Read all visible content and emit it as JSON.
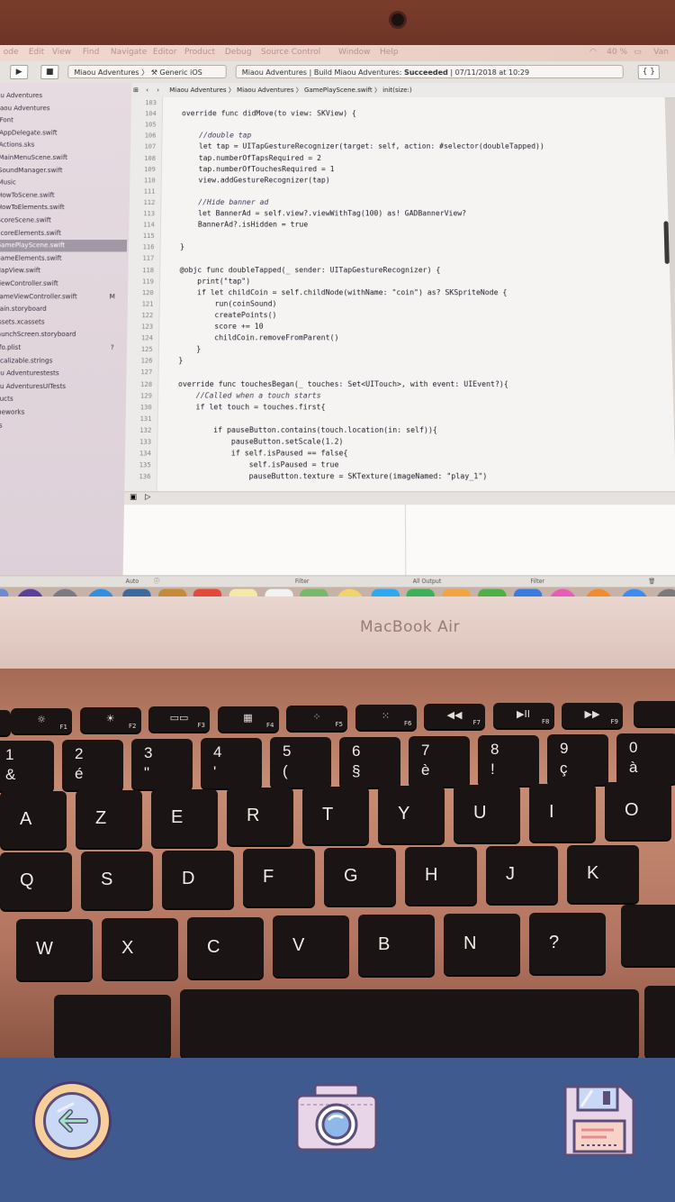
{
  "mac_menubar": {
    "items": [
      "ode",
      "Edit",
      "View",
      "Find",
      "Navigate",
      "Editor",
      "Product",
      "Debug",
      "Source Control",
      "Window",
      "Help"
    ],
    "battery": "40 %",
    "right_text": "Van"
  },
  "xcode_toolbar": {
    "scheme": "Miaou Adventures",
    "destination": "Generic iOS Device",
    "status_project": "Miaou Adventures",
    "status_build": "Build Miaou Adventures:",
    "status_result": "Succeeded",
    "status_time": "07/11/2018 at 10:29"
  },
  "jump_bar": {
    "crumbs": [
      "Miaou Adventures",
      "Miaou Adventures",
      "GamePlayScene.swift",
      "init(size:)"
    ]
  },
  "navigator": {
    "items": [
      {
        "label": "u Adventures",
        "badge": ""
      },
      {
        "label": "aou Adventures",
        "badge": ""
      },
      {
        "label": "Font",
        "badge": ""
      },
      {
        "label": "AppDelegate.swift",
        "badge": ""
      },
      {
        "label": "Actions.sks",
        "badge": ""
      },
      {
        "label": "MainMenuScene.swift",
        "badge": ""
      },
      {
        "label": "SoundManager.swift",
        "badge": ""
      },
      {
        "label": "Music",
        "badge": ""
      },
      {
        "label": "HowToScene.swift",
        "badge": ""
      },
      {
        "label": "HowToElements.swift",
        "badge": ""
      },
      {
        "label": "ScoreScene.swift",
        "badge": ""
      },
      {
        "label": "ScoreElements.swift",
        "badge": ""
      },
      {
        "label": "GamePlayScene.swift",
        "badge": "",
        "selected": true
      },
      {
        "label": "GameElements.swift",
        "badge": ""
      },
      {
        "label": "MapView.swift",
        "badge": ""
      },
      {
        "label": "ViewController.swift",
        "badge": ""
      },
      {
        "label": "GameViewController.swift",
        "badge": "M"
      },
      {
        "label": "Main.storyboard",
        "badge": ""
      },
      {
        "label": "Assets.xcassets",
        "badge": ""
      },
      {
        "label": "LaunchScreen.storyboard",
        "badge": ""
      },
      {
        "label": "Info.plist",
        "badge": "?"
      },
      {
        "label": "Localizable.strings",
        "badge": ""
      },
      {
        "label": "aou Adventurestests",
        "badge": ""
      },
      {
        "label": "aou AdventuresUITests",
        "badge": ""
      },
      {
        "label": "oducts",
        "badge": ""
      },
      {
        "label": "ameworks",
        "badge": ""
      },
      {
        "label": "ods",
        "badge": ""
      }
    ]
  },
  "editor": {
    "line_numbers": [
      "103",
      "104",
      "105",
      "106",
      "107",
      "108",
      "109",
      "110",
      "111",
      "112",
      "113",
      "114",
      "115",
      "116",
      "117",
      "118",
      "119",
      "120",
      "121",
      "122",
      "123",
      "124",
      "125",
      "126",
      "127",
      "128",
      "129",
      "130",
      "131",
      "132",
      "133",
      "134",
      "135",
      "136"
    ],
    "lines": [
      {
        "text": "",
        "comment": false
      },
      {
        "text": "override func didMove(to view: SKView) {",
        "comment": false
      },
      {
        "text": "",
        "comment": false
      },
      {
        "text": "    //double tap",
        "comment": true
      },
      {
        "text": "    let tap = UITapGestureRecognizer(target: self, action: #selector(doubleTapped))",
        "comment": false
      },
      {
        "text": "    tap.numberOfTapsRequired = 2",
        "comment": false
      },
      {
        "text": "    tap.numberOfTouchesRequired = 1",
        "comment": false
      },
      {
        "text": "    view.addGestureRecognizer(tap)",
        "comment": false
      },
      {
        "text": "",
        "comment": false
      },
      {
        "text": "    //Hide banner ad",
        "comment": true
      },
      {
        "text": "    let BannerAd = self.view?.viewWithTag(100) as! GADBannerView?",
        "comment": false
      },
      {
        "text": "    BannerAd?.isHidden = true",
        "comment": false
      },
      {
        "text": "",
        "comment": false
      },
      {
        "text": "}",
        "comment": false
      },
      {
        "text": "",
        "comment": false
      },
      {
        "text": "@objc func doubleTapped(_ sender: UITapGestureRecognizer) {",
        "comment": false
      },
      {
        "text": "    print(\"tap\")",
        "comment": false
      },
      {
        "text": "    if let childCoin = self.childNode(withName: \"coin\") as? SKSpriteNode {",
        "comment": false
      },
      {
        "text": "        run(coinSound)",
        "comment": false
      },
      {
        "text": "        createPoints()",
        "comment": false
      },
      {
        "text": "        score += 10",
        "comment": false
      },
      {
        "text": "        childCoin.removeFromParent()",
        "comment": false
      },
      {
        "text": "    }",
        "comment": false
      },
      {
        "text": "}",
        "comment": false
      },
      {
        "text": "",
        "comment": false
      },
      {
        "text": "override func touchesBegan(_ touches: Set<UITouch>, with event: UIEvent?){",
        "comment": false
      },
      {
        "text": "    //Called when a touch starts",
        "comment": true
      },
      {
        "text": "    if let touch = touches.first{",
        "comment": false
      },
      {
        "text": "",
        "comment": false
      },
      {
        "text": "        if pauseButton.contains(touch.location(in: self)){",
        "comment": false
      },
      {
        "text": "            pauseButton.setScale(1.2)",
        "comment": false
      },
      {
        "text": "            if self.isPaused == false{",
        "comment": false
      },
      {
        "text": "                self.isPaused = true",
        "comment": false
      },
      {
        "text": "                pauseButton.texture = SKTexture(imageNamed: \"play_1\")",
        "comment": false
      }
    ]
  },
  "debug_area": {
    "auto_label": "Auto",
    "filter_left": "Filter",
    "output_label": "All Output",
    "filter_right": "Filter"
  },
  "dock": {
    "calendar_day": "9",
    "icons": [
      "finder-icon",
      "siri-icon",
      "launchpad-icon",
      "safari-icon",
      "photo-app-icon",
      "notes-icon",
      "calendar-icon",
      "stickies-icon",
      "reminders-icon",
      "maps-icon",
      "photos-icon",
      "messages-icon",
      "facetime-icon",
      "pages-icon",
      "numbers-icon",
      "keynote-icon",
      "itunes-icon",
      "ibooks-icon",
      "appstore-icon",
      "preferences-icon"
    ]
  },
  "laptop": {
    "brand": "MacBook Air"
  },
  "keyboard": {
    "fn_row": [
      {
        "icon": "☼",
        "label": "F1"
      },
      {
        "icon": "☀",
        "label": "F2"
      },
      {
        "icon": "▭▭",
        "label": "F3"
      },
      {
        "icon": "▦",
        "label": "F4"
      },
      {
        "icon": "⁘",
        "label": "F5"
      },
      {
        "icon": "⁙",
        "label": "F6"
      },
      {
        "icon": "◀◀",
        "label": "F7"
      },
      {
        "icon": "▶II",
        "label": "F8"
      },
      {
        "icon": "▶▶",
        "label": "F9"
      }
    ],
    "number_row": [
      {
        "top": "1",
        "bottom": "&"
      },
      {
        "top": "2",
        "bottom": "é"
      },
      {
        "top": "3",
        "bottom": "\""
      },
      {
        "top": "4",
        "bottom": "'"
      },
      {
        "top": "5",
        "bottom": "("
      },
      {
        "top": "6",
        "bottom": "§"
      },
      {
        "top": "7",
        "bottom": "è"
      },
      {
        "top": "8",
        "bottom": "!"
      },
      {
        "top": "9",
        "bottom": "ç"
      },
      {
        "top": "0",
        "bottom": "à"
      }
    ],
    "row1": [
      "A",
      "Z",
      "E",
      "R",
      "T",
      "Y",
      "U",
      "I",
      "O"
    ],
    "row2": [
      "Q",
      "S",
      "D",
      "F",
      "G",
      "H",
      "J",
      "K"
    ],
    "row3": [
      "W",
      "X",
      "C",
      "V",
      "B",
      "N",
      "?"
    ]
  },
  "app_toolbar": {
    "back": "back-arrow-icon",
    "camera": "camera-icon",
    "save": "floppy-disk-icon",
    "colors": {
      "bar": "#3f5a8f",
      "accent": "#f6cf9a",
      "outline": "#4b3b6e"
    }
  }
}
